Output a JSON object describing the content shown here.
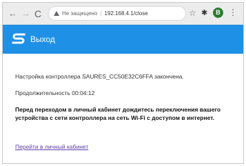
{
  "browser": {
    "back_icon": "arrow-left-icon",
    "back_glyph": "←",
    "forward_glyph": "→",
    "reload_glyph": "C",
    "security_label": "Не защищено",
    "url": "192.168.4.1/close",
    "star_glyph": "☆",
    "extension_glyph": "✱",
    "avatar_letter": "В",
    "menu_glyph": "⋮"
  },
  "header": {
    "title": "Выход",
    "background_color": "#1e90e6"
  },
  "content": {
    "status_text": "Настройка контроллера SAURES_CC50E32C6FFA закончена.",
    "duration_text": "Продолжительность 00:04:12",
    "warning_text": "Перед переходом в личный кабинет дождитесь переключения вашего устройства с сети контроллера на сеть Wi-Fi с доступом в интернет.",
    "link_text": "Перейти в личный кабинет",
    "link_color": "#5b3fa8"
  }
}
